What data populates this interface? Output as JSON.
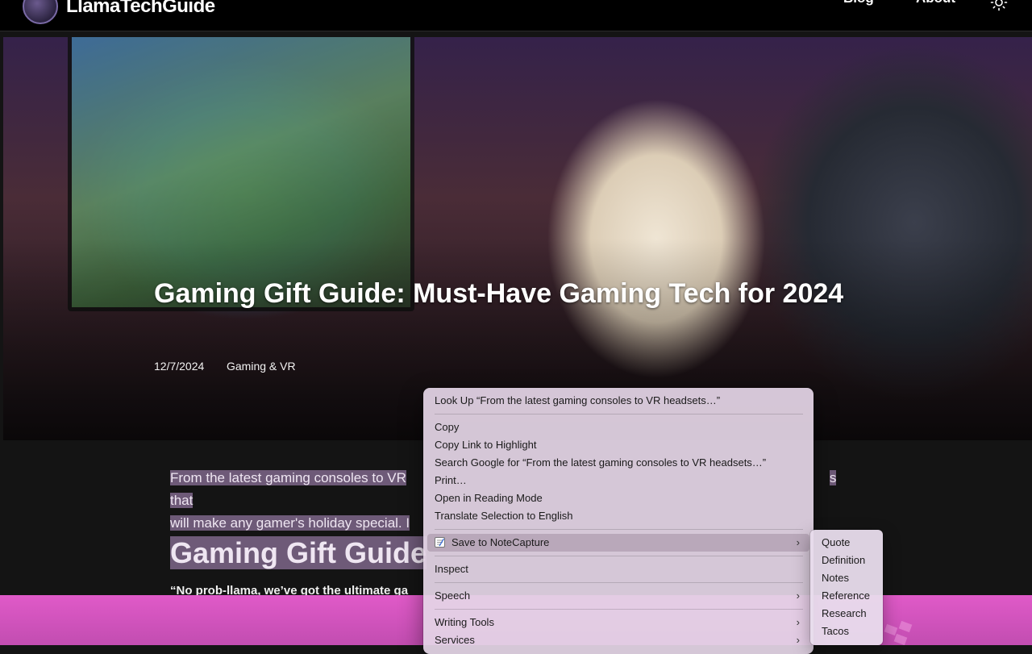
{
  "header": {
    "site_title": "LlamaTechGuide",
    "nav": [
      "Blog",
      "About"
    ]
  },
  "hero": {
    "title": "Gaming Gift Guide: Must-Have Gaming Tech for 2024",
    "date": "12/7/2024",
    "category": "Gaming & VR"
  },
  "article": {
    "intro_line1_start": "From the latest gaming consoles to VR",
    "intro_line1_end": "s that",
    "intro_line2": "will make any gamer's holiday special. I",
    "heading": "Gaming Gift Guide",
    "quote": "“No prob-llama, we’ve got the ultimate ga"
  },
  "context_menu": {
    "items": [
      "Look Up “From the latest gaming consoles to VR headsets…”",
      "Copy",
      "Copy Link to Highlight",
      "Search Google for “From the latest gaming consoles to VR headsets…”",
      "Print…",
      "Open in Reading Mode",
      "Translate Selection to English",
      "Save to NoteCapture",
      "Inspect",
      "Speech",
      "Writing Tools",
      "Services"
    ],
    "submenu_chevron": "›",
    "submenu": [
      "Quote",
      "Definition",
      "Notes",
      "Reference",
      "Research",
      "Tacos"
    ]
  },
  "colors": {
    "selection_highlight": "#6e5a78",
    "footer_bar": "#d453bd",
    "menu_bg": "#e4d5e6"
  },
  "icons": {
    "theme_toggle": "sun-icon",
    "save_extension": "note-icon",
    "submenu_arrow": "chevron-right-icon"
  }
}
